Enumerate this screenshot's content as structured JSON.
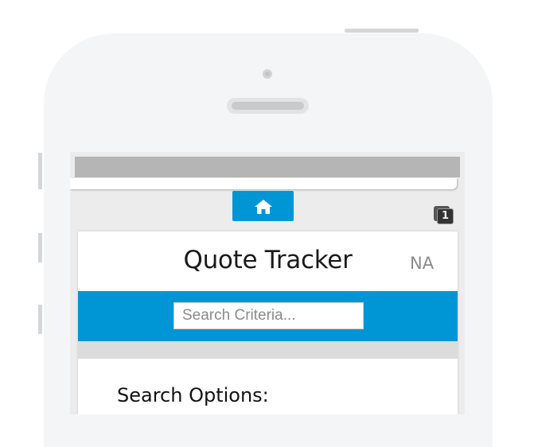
{
  "header": {
    "home_icon": "home-icon",
    "notification_badge": "1"
  },
  "card": {
    "title": "Quote Tracker",
    "region": "NA"
  },
  "search": {
    "placeholder": "Search Criteria..."
  },
  "search_options": {
    "heading": "Search Options:"
  },
  "colors": {
    "accent": "#0096d6",
    "phone_body": "#f4f5f6",
    "status_bar": "#b5b5b5"
  }
}
